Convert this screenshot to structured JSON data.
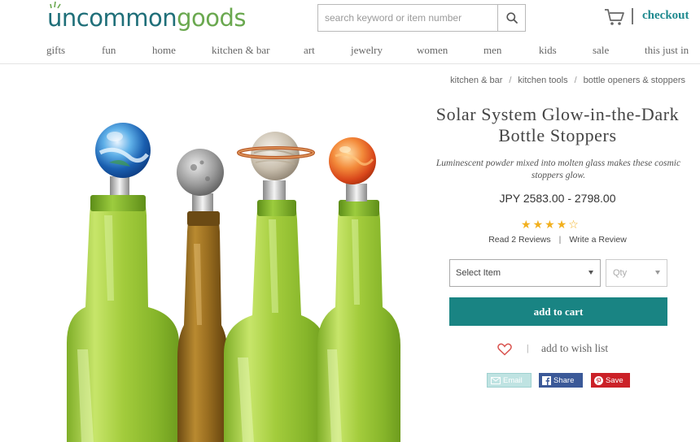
{
  "header": {
    "logo_part1": "uncommon",
    "logo_part2": "goods",
    "search_placeholder": "search keyword or item number",
    "checkout_label": "checkout"
  },
  "nav": {
    "items": [
      "gifts",
      "fun",
      "home",
      "kitchen & bar",
      "art",
      "jewelry",
      "women",
      "men",
      "kids",
      "sale",
      "this just in"
    ]
  },
  "breadcrumb": [
    "kitchen & bar",
    "kitchen tools",
    "bottle openers & stoppers"
  ],
  "breadcrumb_separator": "/",
  "product": {
    "title": "Solar System Glow-in-the-Dark Bottle Stoppers",
    "description": "Luminescent powder mixed into molten glass makes these cosmic stoppers glow.",
    "price": "JPY 2583.00 - 2798.00",
    "rating": 4,
    "rating_max": 5,
    "read_reviews": "Read 2 Reviews",
    "write_review": "Write a Review",
    "select_item": "Select Item",
    "qty_placeholder": "Qty",
    "add_to_cart": "add to cart",
    "wish_sep": "|",
    "wish_label": "add to wish list"
  },
  "share": {
    "email": "Email",
    "facebook": "Share",
    "pinterest": "Save"
  },
  "colors": {
    "teal_primary": "#198483",
    "logo_teal": "#1f6f79",
    "logo_green": "#6aa84f",
    "star": "#f2b01e",
    "facebook": "#3b5998",
    "pinterest": "#cb2027"
  },
  "icons": [
    "search-icon",
    "cart-icon",
    "heart-icon",
    "email-icon",
    "facebook-icon",
    "pinterest-icon",
    "star-icon"
  ]
}
